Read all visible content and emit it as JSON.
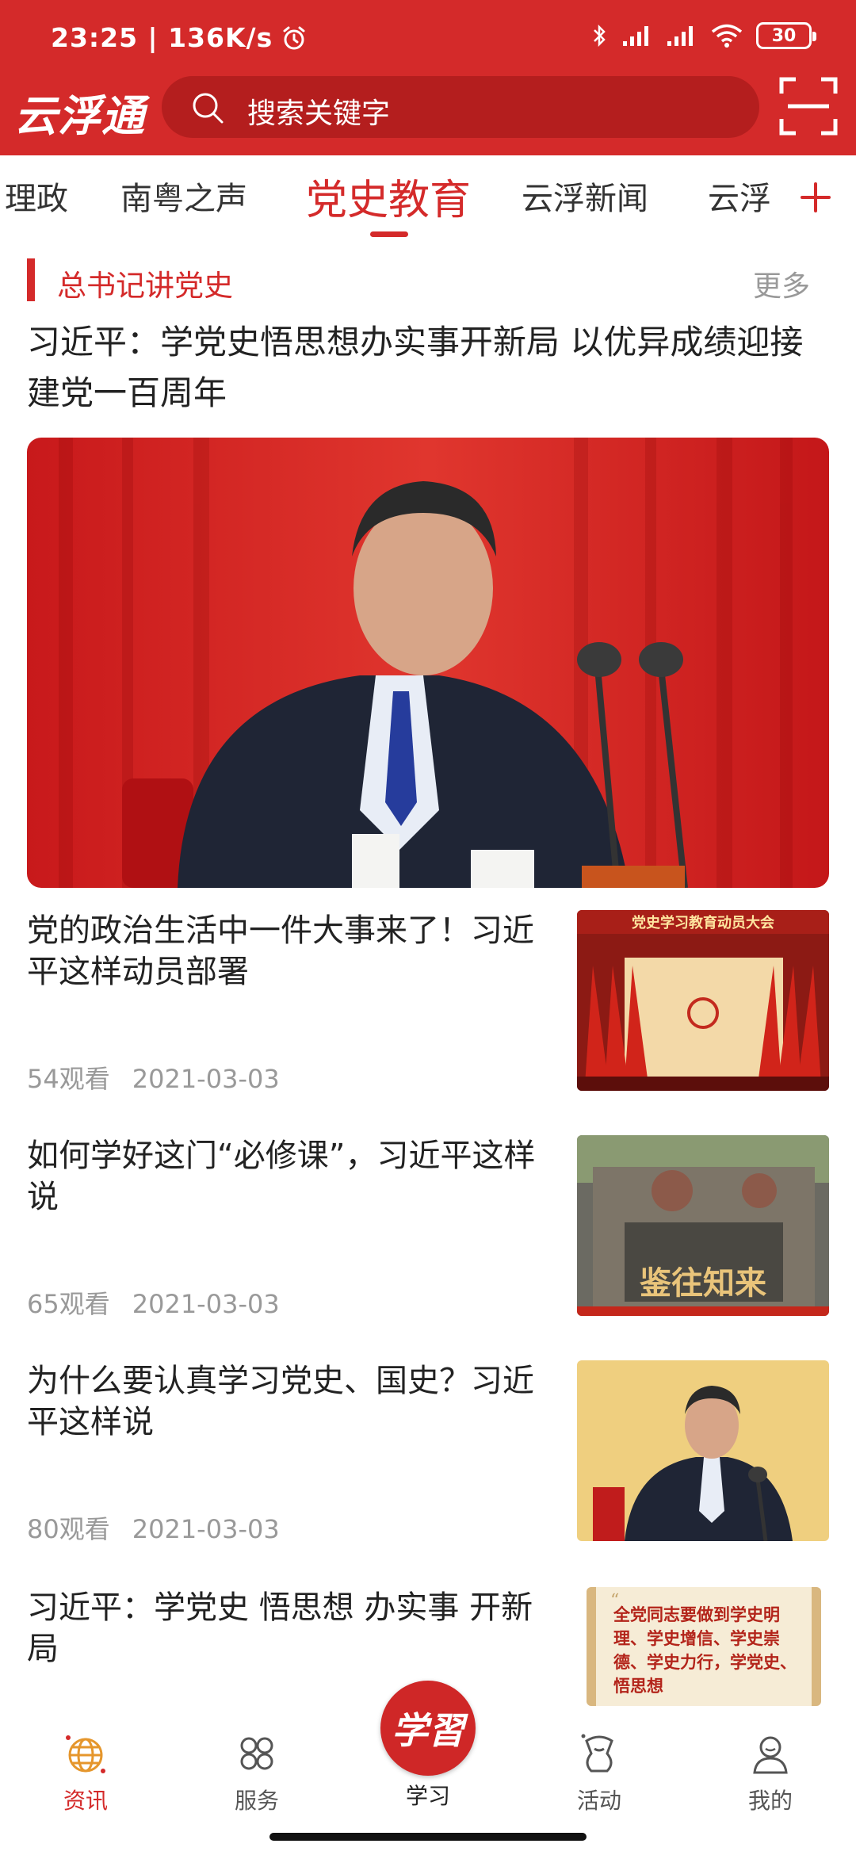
{
  "status_bar": {
    "time_speed": "23:25 | 136K/s",
    "battery": "30"
  },
  "app": {
    "logo": "云浮通",
    "search_placeholder": "搜索关键字"
  },
  "tabs": [
    {
      "label": "理政",
      "active": false
    },
    {
      "label": "南粤之声",
      "active": false
    },
    {
      "label": "党史教育",
      "active": true
    },
    {
      "label": "云浮新闻",
      "active": false
    },
    {
      "label": "云浮",
      "active": false
    }
  ],
  "section": {
    "title": "总书记讲党史",
    "more": "更多"
  },
  "featured": {
    "title": "习近平：学党史悟思想办实事开新局 以优异成绩迎接建党一百周年"
  },
  "articles": [
    {
      "title": "党的政治生活中一件大事来了！习近平这样动员部署",
      "views": "54观看",
      "date": "2021-03-03",
      "thumb_caption": "党史学习教育动员大会"
    },
    {
      "title": "如何学好这门“必修课”，习近平这样说",
      "views": "65观看",
      "date": "2021-03-03",
      "thumb_caption": "鉴往知来"
    },
    {
      "title": "为什么要认真学习党史、国史？习近平这样说",
      "views": "80观看",
      "date": "2021-03-03",
      "thumb_caption": ""
    },
    {
      "title": "习近平：学党史 悟思想 办实事 开新局",
      "views": "",
      "date": "",
      "thumb_caption": "全党同志要做到学史明理、学史增信、学史崇德、学史力行，学党史、悟思想"
    }
  ],
  "bottom_nav": {
    "news": "资讯",
    "services": "服务",
    "study": "学习",
    "study_badge": "学習",
    "activities": "活动",
    "mine": "我的"
  },
  "colors": {
    "brand_red": "#d42a2a",
    "text_dark": "#222222",
    "text_muted": "#999999"
  }
}
